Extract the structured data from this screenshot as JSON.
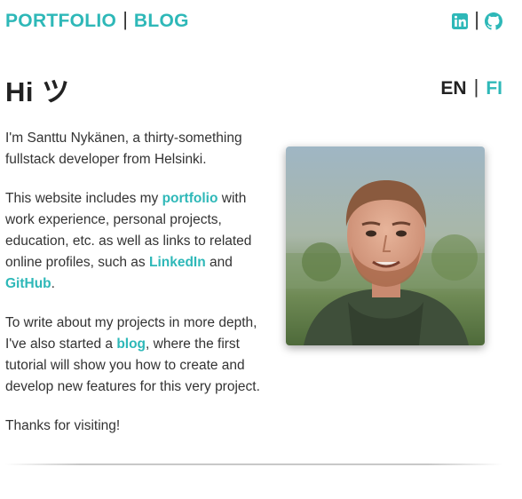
{
  "nav": {
    "portfolio_label": "PORTFOLIO",
    "separator": "|",
    "blog_label": "BLOG"
  },
  "social": {
    "linkedin_icon": "linkedin-icon",
    "github_icon": "github-icon",
    "separator": "|"
  },
  "hero": {
    "greeting": "Hi ツ"
  },
  "language": {
    "en_label": "EN",
    "separator": "|",
    "fi_label": "FI"
  },
  "intro": {
    "p1": "I'm Santtu Nykänen, a thirty-something fullstack developer from Helsinki.",
    "p2_before": "This website includes my ",
    "p2_portfolio": "portfolio",
    "p2_mid": " with work experience, personal projects, education, etc. as well as links to related online profiles, such as ",
    "p2_linkedin": "LinkedIn",
    "p2_and": " and ",
    "p2_github": "GitHub",
    "p2_end": ".",
    "p3_before": "To write about my projects in more depth, I've also started a ",
    "p3_blog": "blog",
    "p3_after": ", where the first tutorial will show you how to create and develop new features for this very project.",
    "p4": "Thanks for visiting!"
  },
  "colors": {
    "accent": "#2eb8b8",
    "text": "#333333",
    "heading": "#222222"
  }
}
